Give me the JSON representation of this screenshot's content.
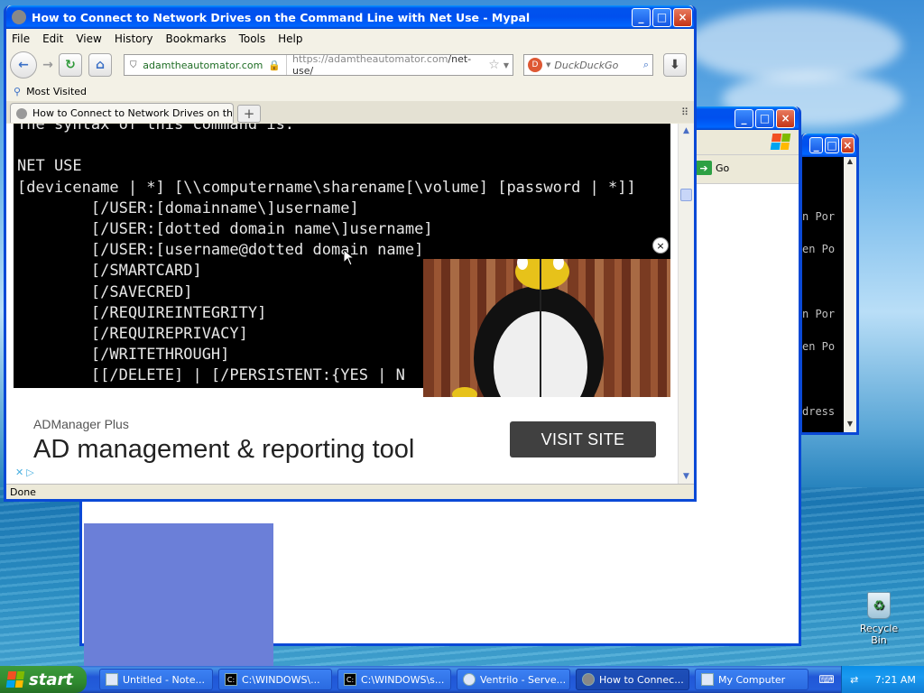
{
  "desktop": {
    "recycle_bin_label": "Recycle Bin"
  },
  "browser": {
    "title": "How to Connect to Network Drives on the Command Line with Net Use - Mypal",
    "menu": [
      "File",
      "Edit",
      "View",
      "History",
      "Bookmarks",
      "Tools",
      "Help"
    ],
    "site_identity": "adamtheautomator.com",
    "url_host": "https://adamtheautomator.com",
    "url_path": "/net-use/",
    "search_placeholder": "DuckDuckGo",
    "bookmark_label": "Most Visited",
    "tab_title": "How to Connect to Network Drives on the C...",
    "code_lines": [
      "The syntax of this command is:",
      "",
      "NET USE",
      "[devicename | *] [\\\\computername\\sharename[\\volume] [password | *]]",
      "        [/USER:[domainname\\]username]",
      "        [/USER:[dotted domain name\\]username]",
      "        [/USER:[username@dotted domain name]",
      "        [/SMARTCARD]",
      "        [/SAVECRED]",
      "        [/REQUIREINTEGRITY]",
      "        [/REQUIREPRIVACY]",
      "        [/WRITETHROUGH]",
      "        [[/DELETE] | [/PERSISTENT:{YES | N"
    ],
    "ad": {
      "brand": "ADManager Plus",
      "headline": "AD management & reporting tool",
      "cta": "VISIT SITE"
    },
    "status": "Done"
  },
  "mycomputer_window": {
    "go_label": "Go"
  },
  "cmd_window": {
    "lines": [
      "n Por",
      "en Po",
      "",
      "n Por",
      "en Po",
      "",
      "dress",
      "",
      "",
      "",
      "",
      "",
      "",
      "dress"
    ]
  },
  "taskbar": {
    "start_label": "start",
    "tasks": [
      "Untitled - Note...",
      "C:\\WINDOWS\\...",
      "C:\\WINDOWS\\s...",
      "Ventrilo - Serve...",
      "How to Connec...",
      "My Computer"
    ],
    "clock": "7:21 AM"
  }
}
